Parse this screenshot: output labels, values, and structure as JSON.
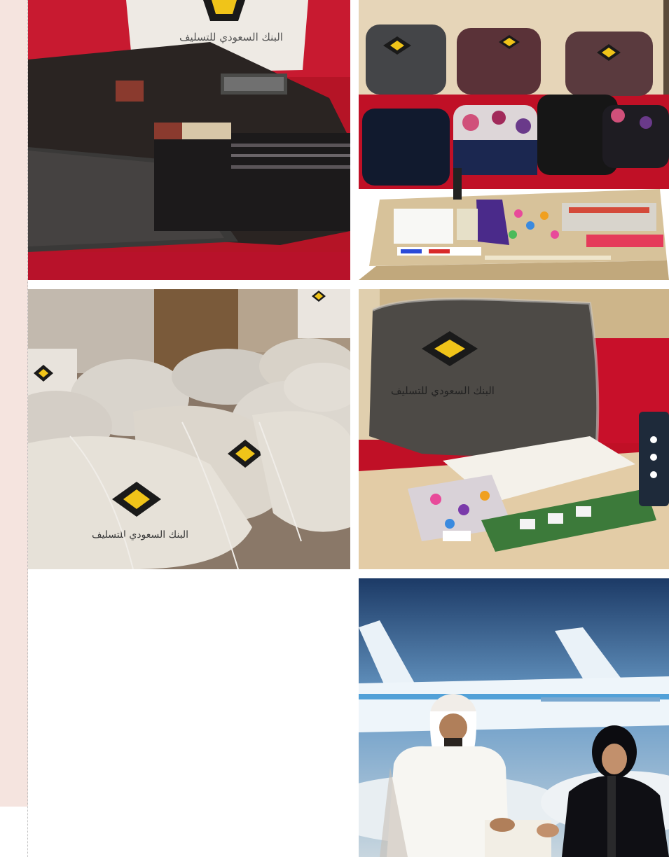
{
  "gallery": {
    "photos": [
      {
        "name": "gift-bag-clothing-photo",
        "logo_text": "البنك السعودي للتسليف"
      },
      {
        "name": "school-backpacks-supplies-photo",
        "logo_text": ""
      },
      {
        "name": "cloth-drawstring-bags-photo",
        "logo_text": "البنك السعودي للتسليف"
      },
      {
        "name": "logo-backpack-stationery-photo",
        "logo_text": "البنك السعودي للتسليف"
      },
      {
        "name": "award-handover-airplane-photo",
        "logo_text": ""
      }
    ]
  },
  "colors": {
    "sidebar": "#f5e4df",
    "logo_yellow": "#f0c419",
    "logo_black": "#1a1a1a",
    "sofa_red": "#c4122a"
  }
}
